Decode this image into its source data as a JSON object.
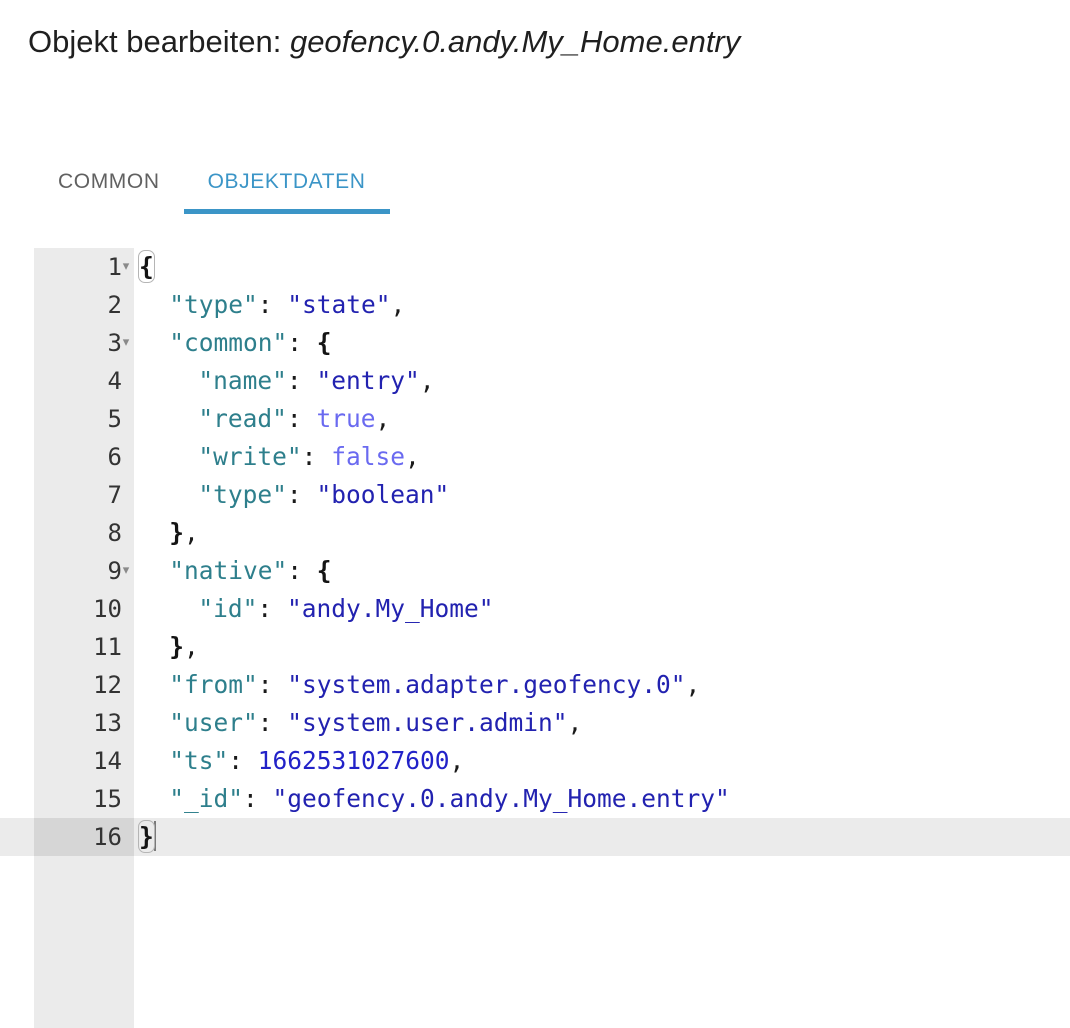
{
  "header": {
    "title_prefix": "Objekt bearbeiten: ",
    "object_id": "geofency.0.andy.My_Home.entry"
  },
  "tabs": [
    {
      "label": "COMMON",
      "active": false
    },
    {
      "label": "OBJEKTDATEN",
      "active": true
    }
  ],
  "colors": {
    "accent": "#3b95c7",
    "tab_inactive": "#616161",
    "gutter_bg": "#ebebeb",
    "active_line_bg": "#ebebeb",
    "active_gutter_bg": "#d6d6d6",
    "key": "#2e7f8c",
    "string": "#2222b0",
    "number": "#2222c8",
    "boolean": "#6a6af0",
    "punctuation": "#1a1a1a"
  },
  "editor": {
    "active_line": 16,
    "cursor_line": 16,
    "lines": [
      {
        "n": "1",
        "fold": "▾",
        "indent": 0,
        "text": "{"
      },
      {
        "n": "2",
        "fold": "",
        "indent": 1,
        "text": "\"type\": \"state\","
      },
      {
        "n": "3",
        "fold": "▾",
        "indent": 1,
        "text": "\"common\": {"
      },
      {
        "n": "4",
        "fold": "",
        "indent": 2,
        "text": "\"name\": \"entry\","
      },
      {
        "n": "5",
        "fold": "",
        "indent": 2,
        "text": "\"read\": true,"
      },
      {
        "n": "6",
        "fold": "",
        "indent": 2,
        "text": "\"write\": false,"
      },
      {
        "n": "7",
        "fold": "",
        "indent": 2,
        "text": "\"type\": \"boolean\""
      },
      {
        "n": "8",
        "fold": "",
        "indent": 1,
        "text": "},"
      },
      {
        "n": "9",
        "fold": "▾",
        "indent": 1,
        "text": "\"native\": {"
      },
      {
        "n": "10",
        "fold": "",
        "indent": 2,
        "text": "\"id\": \"andy.My_Home\""
      },
      {
        "n": "11",
        "fold": "",
        "indent": 1,
        "text": "},"
      },
      {
        "n": "12",
        "fold": "",
        "indent": 1,
        "text": "\"from\": \"system.adapter.geofency.0\","
      },
      {
        "n": "13",
        "fold": "",
        "indent": 1,
        "text": "\"user\": \"system.user.admin\","
      },
      {
        "n": "14",
        "fold": "",
        "indent": 1,
        "text": "\"ts\": 1662531027600,"
      },
      {
        "n": "15",
        "fold": "",
        "indent": 1,
        "text": "\"_id\": \"geofency.0.andy.My_Home.entry\""
      },
      {
        "n": "16",
        "fold": "",
        "indent": 0,
        "text": "}"
      }
    ],
    "json_object": {
      "type": "state",
      "common": {
        "name": "entry",
        "read": true,
        "write": false,
        "type": "boolean"
      },
      "native": {
        "id": "andy.My_Home"
      },
      "from": "system.adapter.geofency.0",
      "user": "system.user.admin",
      "ts": 1662531027600,
      "_id": "geofency.0.andy.My_Home.entry"
    }
  }
}
